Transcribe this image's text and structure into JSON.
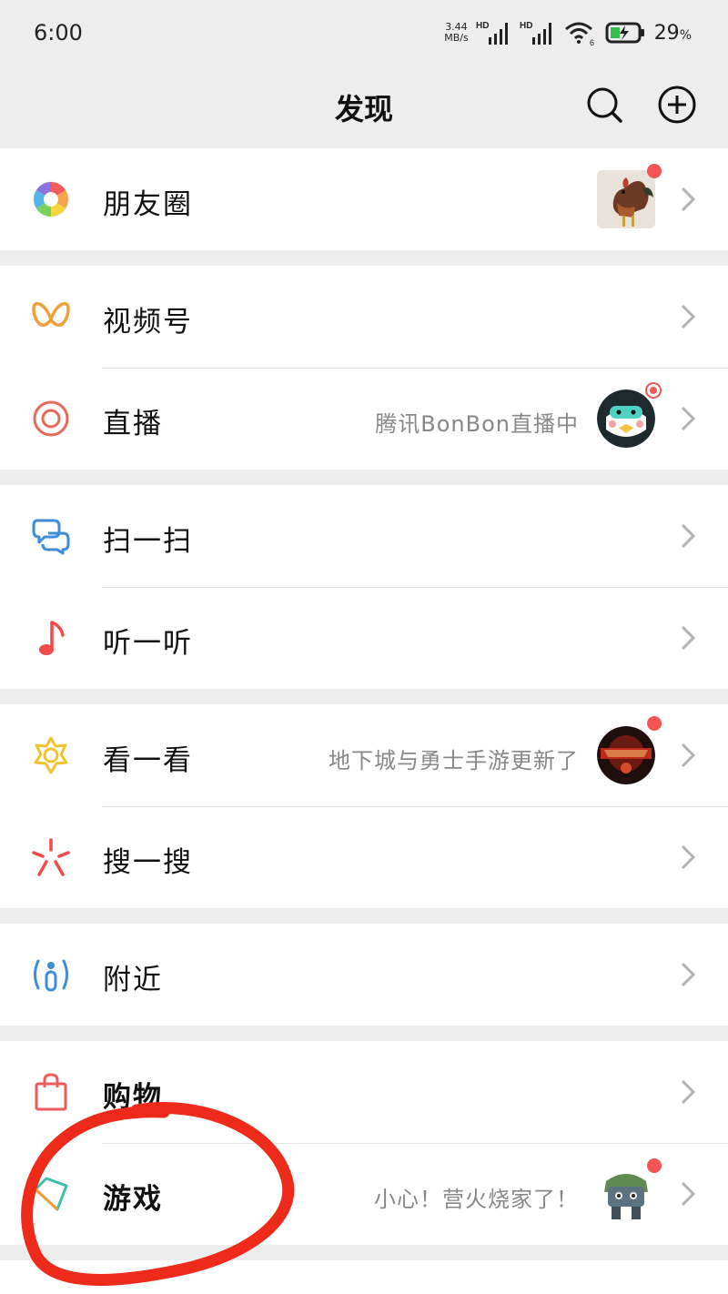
{
  "status_bar": {
    "time": "6:00",
    "net_speed_value": "3.44",
    "net_speed_unit": "MB/s",
    "hd1": "HD",
    "hd2": "HD",
    "wifi_badge": "6",
    "battery_percent": "29",
    "battery_unit": "%"
  },
  "header": {
    "title": "发现",
    "search_icon": "search-icon",
    "add_icon": "plus-circle-icon"
  },
  "items": [
    {
      "key": "moments",
      "label": "朋友圈",
      "sub": "",
      "icon": "aperture-icon",
      "has_thumb": true,
      "dot": true
    },
    {
      "key": "channels",
      "label": "视频号",
      "sub": "",
      "icon": "butterfly-icon"
    },
    {
      "key": "live",
      "label": "直播",
      "sub": "腾讯BonBon直播中",
      "icon": "live-circle-icon",
      "has_thumb": true,
      "dot": true
    },
    {
      "key": "scan",
      "label": "扫一扫",
      "sub": "",
      "icon": "scan-icon"
    },
    {
      "key": "shake",
      "label": "听一听",
      "sub": "",
      "icon": "music-note-icon"
    },
    {
      "key": "top-stories",
      "label": "看一看",
      "sub": "地下城与勇士手游更新了",
      "icon": "star-flower-icon",
      "has_thumb": true,
      "dot": true
    },
    {
      "key": "search",
      "label": "搜一搜",
      "sub": "",
      "icon": "search-sparkle-icon"
    },
    {
      "key": "nearby",
      "label": "附近",
      "sub": "",
      "icon": "nearby-person-icon"
    },
    {
      "key": "shopping",
      "label": "购物",
      "sub": "",
      "icon": "shopping-bag-icon"
    },
    {
      "key": "games",
      "label": "游戏",
      "sub": "小心！营火烧家了！",
      "icon": "game-diamond-icon",
      "has_thumb": true,
      "dot": true
    }
  ],
  "colors": {
    "background": "#ededed",
    "row": "#ffffff",
    "badge_red": "#f25553",
    "annotation_red": "#ee2a1a"
  }
}
